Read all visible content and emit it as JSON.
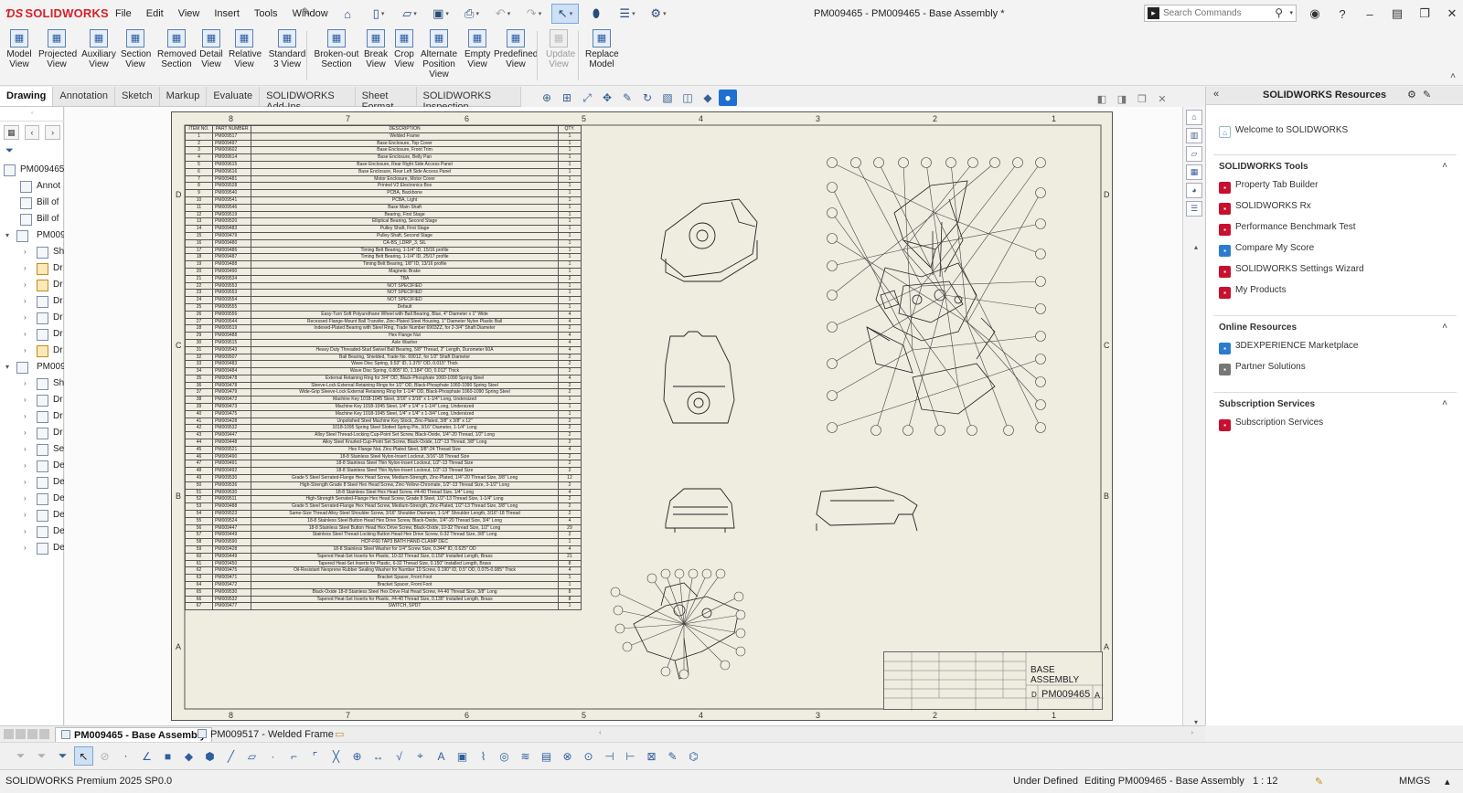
{
  "app": {
    "brand": "SOLIDWORKS",
    "document_title": "PM009465 - PM009465 - Base Assembly *",
    "menu": [
      "File",
      "Edit",
      "View",
      "Insert",
      "Tools",
      "Window"
    ],
    "search_placeholder": "Search Commands"
  },
  "command_manager": {
    "commands": [
      {
        "label": "Model\nView",
        "icon": "model-view-icon",
        "enabled": true
      },
      {
        "label": "Projected\nView",
        "icon": "projected-view-icon",
        "enabled": true
      },
      {
        "label": "Auxiliary\nView",
        "icon": "auxiliary-view-icon",
        "enabled": true
      },
      {
        "label": "Section\nView",
        "icon": "section-view-icon",
        "enabled": true
      },
      {
        "label": "Removed\nSection",
        "icon": "removed-section-icon",
        "enabled": true
      },
      {
        "label": "Detail\nView",
        "icon": "detail-view-icon",
        "enabled": true
      },
      {
        "label": "Relative\nView",
        "icon": "relative-view-icon",
        "enabled": true
      },
      {
        "label": "Standard\n3 View",
        "icon": "standard-3-view-icon",
        "enabled": true
      },
      {
        "label": "Broken-out\nSection",
        "icon": "broken-out-section-icon",
        "enabled": true
      },
      {
        "label": "Break\nView",
        "icon": "break-view-icon",
        "enabled": true
      },
      {
        "label": "Crop\nView",
        "icon": "crop-view-icon",
        "enabled": true
      },
      {
        "label": "Alternate\nPosition\nView",
        "icon": "alternate-position-view-icon",
        "enabled": true
      },
      {
        "label": "Empty\nView",
        "icon": "empty-view-icon",
        "enabled": true
      },
      {
        "label": "Predefined\nView",
        "icon": "predefined-view-icon",
        "enabled": true
      },
      {
        "label": "Update\nView",
        "icon": "update-view-icon",
        "enabled": false
      },
      {
        "label": "Replace\nModel",
        "icon": "replace-model-icon",
        "enabled": true
      }
    ]
  },
  "tabs": [
    {
      "label": "Drawing",
      "active": true
    },
    {
      "label": "Annotation",
      "active": false
    },
    {
      "label": "Sketch",
      "active": false
    },
    {
      "label": "Markup",
      "active": false
    },
    {
      "label": "Evaluate",
      "active": false
    },
    {
      "label": "SOLIDWORKS Add-Ins",
      "active": false
    },
    {
      "label": "Sheet Format",
      "active": false
    },
    {
      "label": "SOLIDWORKS Inspection",
      "active": false
    }
  ],
  "feature_tree": [
    {
      "label": "PM009465",
      "icon": "drawing-icon",
      "depth": 0,
      "expander": ""
    },
    {
      "label": "Annot",
      "icon": "annotations-icon",
      "depth": 1,
      "expander": ""
    },
    {
      "label": "Bill of",
      "icon": "bom-icon",
      "depth": 1,
      "expander": ""
    },
    {
      "label": "Bill of",
      "icon": "bom-icon",
      "depth": 1,
      "expander": ""
    },
    {
      "label": "PM009",
      "icon": "sheet-icon",
      "depth": 0,
      "expander": "▾"
    },
    {
      "label": "Sh",
      "icon": "sheet-format-icon",
      "depth": 2,
      "expander": "›"
    },
    {
      "label": "Dr",
      "icon": "drawing-view-icon",
      "depth": 2,
      "expander": "›"
    },
    {
      "label": "Dr",
      "icon": "drawing-view-icon",
      "depth": 2,
      "expander": "›"
    },
    {
      "label": "Dr",
      "icon": "drawing-view-icon",
      "depth": 2,
      "expander": "›"
    },
    {
      "label": "Dr",
      "icon": "drawing-view-icon",
      "depth": 2,
      "expander": "›"
    },
    {
      "label": "Dr",
      "icon": "drawing-view-icon",
      "depth": 2,
      "expander": "›"
    },
    {
      "label": "Dr",
      "icon": "drawing-view-icon",
      "depth": 2,
      "expander": "›"
    },
    {
      "label": "PM009",
      "icon": "sheet-icon",
      "depth": 0,
      "expander": "▾"
    },
    {
      "label": "Sh",
      "icon": "sheet-format-icon",
      "depth": 2,
      "expander": "›"
    },
    {
      "label": "Dr",
      "icon": "drawing-view-icon",
      "depth": 2,
      "expander": "›"
    },
    {
      "label": "Dr",
      "icon": "drawing-view-icon",
      "depth": 2,
      "expander": "›"
    },
    {
      "label": "Dr",
      "icon": "drawing-view-icon",
      "depth": 2,
      "expander": "›"
    },
    {
      "label": "Se",
      "icon": "section-icon",
      "depth": 2,
      "expander": "›"
    },
    {
      "label": "De",
      "icon": "detail-icon",
      "depth": 2,
      "expander": "›"
    },
    {
      "label": "De",
      "icon": "detail-icon",
      "depth": 2,
      "expander": "›"
    },
    {
      "label": "De",
      "icon": "detail-icon",
      "depth": 2,
      "expander": "›"
    },
    {
      "label": "De",
      "icon": "detail-icon",
      "depth": 2,
      "expander": "›"
    },
    {
      "label": "De",
      "icon": "detail-icon",
      "depth": 2,
      "expander": "›"
    },
    {
      "label": "De",
      "icon": "detail-icon",
      "depth": 2,
      "expander": "›"
    }
  ],
  "sheet": {
    "zones_top": [
      "8",
      "7",
      "6",
      "5",
      "4",
      "3",
      "2",
      "1"
    ],
    "zones_side": [
      "D",
      "C",
      "B",
      "A"
    ],
    "bom_headers": [
      "ITEM NO.",
      "PART NUMBER",
      "DESCRIPTION",
      "QTY."
    ],
    "bom_rows": [
      [
        "1",
        "PM009517",
        "Welded Frame",
        "1"
      ],
      [
        "2",
        "PM009497",
        "Base Enclosure, Top Cover",
        "1"
      ],
      [
        "3",
        "PM009602",
        "Base Enclosure, Front Trim",
        "1"
      ],
      [
        "4",
        "PM009614",
        "Base Enclosure, Belly Pan",
        "1"
      ],
      [
        "5",
        "PM009615",
        "Base Enclosure, Rear Right Side Access Panel",
        "1"
      ],
      [
        "6",
        "PM009616",
        "Base Enclosure, Rear Left Side Access Panel",
        "1"
      ],
      [
        "7",
        "PM009481",
        "Motor Enclosure, Motor Cover",
        "1"
      ],
      [
        "8",
        "PM009528",
        "Printed V2 Electronics Box",
        "1"
      ],
      [
        "9",
        "PM009540",
        "PCBA, Backbone",
        "1"
      ],
      [
        "10",
        "PM009541",
        "PCBA, Light",
        "1"
      ],
      [
        "11",
        "PM009546",
        "Base Main Shaft",
        "1"
      ],
      [
        "12",
        "PM009519",
        "Bearing, First Stage",
        "1"
      ],
      [
        "13",
        "PM009520",
        "Elliptical Bearing, Second Stage",
        "1"
      ],
      [
        "14",
        "PM009483",
        "Pulley Shaft, First Stage",
        "1"
      ],
      [
        "15",
        "PM009479",
        "Pulley Shaft, Second Stage",
        "1"
      ],
      [
        "16",
        "PM009480",
        "CA-BS_LDRP_3, SIL",
        "1"
      ],
      [
        "17",
        "PM009486",
        "Timing Belt Bearing, 1-1/4\" ID, 15/16 profile",
        "1"
      ],
      [
        "18",
        "PM009487",
        "Timing Belt Bearing, 1-1/4\" ID, 25/17 profile",
        "1"
      ],
      [
        "19",
        "PM009488",
        "Timing Belt Bearing, 1/8\" ID, 13/16 profile",
        "1"
      ],
      [
        "20",
        "PM009490",
        "Magnetic Brake",
        "1"
      ],
      [
        "21",
        "PM009534",
        "TBA",
        "2"
      ],
      [
        "22",
        "PM009553",
        "NOT SPECIFIED",
        "1"
      ],
      [
        "23",
        "PM009553",
        "NOT SPECIFIED",
        "1"
      ],
      [
        "24",
        "PM009554",
        "NOT SPECIFIED",
        "1"
      ],
      [
        "25",
        "PM009555",
        "Default",
        "1"
      ],
      [
        "26",
        "PM009556",
        "Easy-Turn Soft Polyurethane Wheel with Ball Bearing, Blue, 4\" Diameter x 1\" Wide",
        "4"
      ],
      [
        "27",
        "PM009544",
        "Recessed Flange-Mount Ball Transfer, Zinc-Plated Steel Housing, 1\" Diameter Nylon Plastic Ball",
        "4"
      ],
      [
        "28",
        "PM009519",
        "Indexed-Plated Bearing with Steel Ring, Trade Number 6903ZZ, for 2-3/4\" Shaft Diameter",
        "2"
      ],
      [
        "29",
        "PM009488",
        "Hex Flange Nut",
        "4"
      ],
      [
        "30",
        "PM009515",
        "Axle Washer",
        "4"
      ],
      [
        "31",
        "PM009543",
        "Heavy Duty Threaded-Stud Swivel Ball Bearing, 5/8\" Thread, 2\" Length, Durometer 60A",
        "4"
      ],
      [
        "32",
        "PM009507",
        "Ball Bearing, Shielded, Trade No. 6901Z, for 1/2\" Shaft Diameter",
        "2"
      ],
      [
        "33",
        "PM009483",
        "Wave Disc Spring, 9.53\" ID, 1.375\" OD, 0.015\" Thick",
        "2"
      ],
      [
        "34",
        "PM009484",
        "Wave Disc Spring, 0.805\" ID, 1.184\" OD, 0.012\" Thick",
        "2"
      ],
      [
        "35",
        "PM009478",
        "External Retaining Ring for 3/4\" OD, Black-Phosphate 1060-1090 Spring Steel",
        "4"
      ],
      [
        "36",
        "PM009478",
        "Sleeve-Lock External Retaining Rings for 1/2\" OD, Black-Phosphate 1060-1090 Spring Steel",
        "2"
      ],
      [
        "37",
        "PM009479",
        "Wide-Grip Sleeve-Lock External Retaining Ring for 1-1/4\" OD, Black-Phosphate 1060-1090 Spring Steel",
        "2"
      ],
      [
        "38",
        "PM009472",
        "Machine Key 1018-1045 Steel, 3/16\" x 3/16\" x 1-1/4\" Long, Undersized",
        "1"
      ],
      [
        "39",
        "PM009473",
        "Machine Key 1018-1045 Steel, 1/4\" x 1/4\" x 1-1/4\" Long, Undersized",
        "1"
      ],
      [
        "40",
        "PM009475",
        "Machine Key 1018-1045 Steel, 1/4\" x 1/4\" x 1-3/4\" Long, Undersized",
        "1"
      ],
      [
        "41",
        "PM009428",
        "Unpolished Steel Machine Key Stock, Zinc-Plated, 3/8\" x 3/8\" x 12\"",
        "2"
      ],
      [
        "42",
        "PM009532",
        "1018-1095 Spring Steel Slotted Spring Pin, 3/16\" Diameter, 1-1/4\" Long",
        "2"
      ],
      [
        "43",
        "PM009447",
        "Alloy Steel Thread-Locking Cup-Point Set Screw, Black-Oxide, 1/4\"-20 Thread, 1/2\" Long",
        "2"
      ],
      [
        "44",
        "PM009448",
        "Alloy Steel Knurled-Cup-Point Set Screw, Black-Oxide, 1/2\"-13 Thread, 3/8\" Long",
        "2"
      ],
      [
        "45",
        "PM009521",
        "Hex Flange Nut, Zinc-Plated Steel, 3/8\"-24 Thread Size",
        "4"
      ],
      [
        "46",
        "PM009490",
        "18-8 Stainless Steel Nylon-Insert Locknut, 3/16\"-18 Thread Size",
        "2"
      ],
      [
        "47",
        "PM009491",
        "18-8 Stainless Steel Thin Nylon-Insert Locknut, 1/2\"-13 Thread Size",
        "2"
      ],
      [
        "48",
        "PM009492",
        "18-8 Stainless Steel Thin Nylon-Insert Locknut, 1/2\"-13 Thread Size",
        "2"
      ],
      [
        "49",
        "PM009530",
        "Grade 5 Steel Serrated-Flange Hex Head Screw, Medium-Strength, Zinc-Plated, 1/4\"-20 Thread Size, 3/8\" Long",
        "12"
      ],
      [
        "50",
        "PM009536",
        "High-Strength Grade 8 Steel Hex Head Screw, Zinc-Yellow-Chromate, 1/2\"-13 Thread Size, 3-1/2\" Long",
        "2"
      ],
      [
        "51",
        "PM009530",
        "18-8 Stainless Steel Hex Head Screw, #4-40 Thread Size, 1/4\" Long",
        "4"
      ],
      [
        "52",
        "PM009511",
        "High-Strength Serrated-Flange Hex Head Screw, Grade 8 Steel, 1/2\"-13 Thread Size, 1-1/4\" Long",
        "2"
      ],
      [
        "53",
        "PM009488",
        "Grade 5 Steel Serrated-Flange Hex Head Screw, Medium-Strength, Zinc-Plated, 1/2\"-13 Thread Size, 3/8\" Long",
        "2"
      ],
      [
        "54",
        "PM009523",
        "Same-Size Thread Alloy Steel Shoulder Screw, 3/16\" Shoulder Diameter, 1-1/4\" Shoulder Length, 3/16\"-18 Thread",
        "2"
      ],
      [
        "55",
        "PM009524",
        "18-8 Stainless Steel Button Head Hex Drive Screw, Black-Oxide, 1/4\"-20 Thread Size, 3/4\" Long",
        "4"
      ],
      [
        "56",
        "PM009447",
        "18-8 Stainless Steel Button Head Hex Drive Screw, Black-Oxide, 10-32 Thread Size, 1/2\" Long",
        "29"
      ],
      [
        "57",
        "PM009449",
        "Stainless Steel Thread-Locking Button Head Hex Drive Screw, 6-32 Thread Size, 3/8\" Long",
        "2"
      ],
      [
        "58",
        "PM009590",
        "HCP-F60 TAP3 BATH HAND-CLAMP DEC",
        "1"
      ],
      [
        "59",
        "PM009428",
        "18-8 Stainless Steel Washer for 1/4\" Screw Size, 0.344\" ID, 0.625\" OD",
        "4"
      ],
      [
        "60",
        "PM009449",
        "Tapered Heat-Set Inserts for Plastic, 10-32 Thread Size, 0.150\" Installed Length, Brass",
        "21"
      ],
      [
        "61",
        "PM009450",
        "Tapered Heat-Set Inserts for Plastic, 6-32 Thread Size, 0.150\" Installed Length, Brass",
        "8"
      ],
      [
        "62",
        "PM009475",
        "Oil-Resistant Neoprene Rubber Sealing Washer for Number 10 Screw, 0.190\" ID, 0.5\" OD, 0.075-0.085\" Thick",
        "4"
      ],
      [
        "63",
        "PM009471",
        "Bracket Spacer, Front Foot",
        "1"
      ],
      [
        "64",
        "PM009472",
        "Bracket Spacer, Front Foot",
        "1"
      ],
      [
        "65",
        "PM009530",
        "Black-Oxide 18-8 Stainless Steel Hex Drive Flat Head Screw, #4-40 Thread Size, 3/8\" Long",
        "8"
      ],
      [
        "66",
        "PM009532",
        "Tapered Heat-Set Inserts for Plastic, #4-40 Thread Size, 0.135\" Installed Length, Brass",
        "8"
      ],
      [
        "67",
        "PM009477",
        "SWITCH, SPDT",
        "1"
      ]
    ],
    "title": "BASE ASSEMBLY",
    "size": "D",
    "dwg_no": "PM009465",
    "rev": "A"
  },
  "task_pane": {
    "title": "SOLIDWORKS Resources",
    "welcome": "Welcome to SOLIDWORKS",
    "sections": [
      {
        "title": "SOLIDWORKS Tools",
        "items": [
          {
            "label": "Property Tab Builder",
            "icon": "property-tab-builder-icon",
            "color": "#c8102e"
          },
          {
            "label": "SOLIDWORKS Rx",
            "icon": "solidworks-rx-icon",
            "color": "#c8102e"
          },
          {
            "label": "Performance Benchmark Test",
            "icon": "benchmark-icon",
            "color": "#c8102e"
          },
          {
            "label": "Compare My Score",
            "icon": "compare-score-icon",
            "color": "#2b7bd0"
          },
          {
            "label": "SOLIDWORKS Settings Wizard",
            "icon": "settings-wizard-icon",
            "color": "#c8102e"
          },
          {
            "label": "My Products",
            "icon": "my-products-icon",
            "color": "#c8102e"
          }
        ]
      },
      {
        "title": "Online Resources",
        "items": [
          {
            "label": "3DEXPERIENCE Marketplace",
            "icon": "marketplace-icon",
            "color": "#2b7bd0"
          },
          {
            "label": "Partner Solutions",
            "icon": "partner-solutions-icon",
            "color": "#777777"
          }
        ]
      },
      {
        "title": "Subscription Services",
        "items": [
          {
            "label": "Subscription Services",
            "icon": "subscription-icon",
            "color": "#c8102e"
          }
        ]
      }
    ]
  },
  "doc_tabs": [
    {
      "label": "PM009465 - Base Assembly",
      "active": true
    },
    {
      "label": "PM009517 - Welded Frame",
      "active": false
    }
  ],
  "status": {
    "product": "SOLIDWORKS Premium 2025 SP0.0",
    "state": "Under Defined",
    "editing": "Editing PM009465 - Base Assembly",
    "scale": "1 : 12",
    "units": "MMGS"
  },
  "colors": {
    "brand_red": "#d62028",
    "sheet_bg": "#efece0",
    "accent_blue": "#1e6fd0"
  }
}
